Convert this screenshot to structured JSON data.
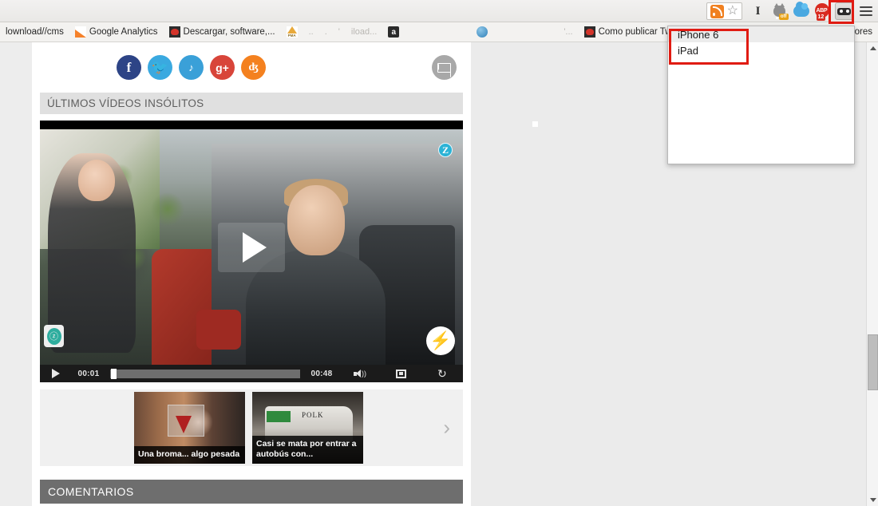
{
  "browser": {
    "toolbar": {
      "icons": [
        {
          "name": "rss-icon",
          "label": "RSS"
        },
        {
          "name": "bookmark-star-icon",
          "label": "Bookmark"
        },
        {
          "name": "evernote-icon",
          "label": "I"
        },
        {
          "name": "ghostery-icon",
          "label": "off"
        },
        {
          "name": "cloud-icon",
          "label": "Cloud"
        },
        {
          "name": "adblock-plus-icon",
          "label": "ABP",
          "badge": "12"
        },
        {
          "name": "user-agent-switcher-icon",
          "label": "User Agent Switcher"
        },
        {
          "name": "menu-icon",
          "label": "Menu"
        }
      ],
      "evernote_label": "I",
      "ghostery_badge": "off",
      "abp_label": "ABP",
      "abp_badge": "12"
    },
    "bookmarks": [
      {
        "label": "lownload//cms",
        "icon": "none"
      },
      {
        "label": "Google Analytics",
        "icon": "chart-icon"
      },
      {
        "label": "Descargar, software,...",
        "icon": "download-icon"
      },
      {
        "label": "PMA",
        "icon": "phpmyadmin-icon"
      },
      {
        "label": "..",
        "icon": "none"
      },
      {
        "label": ".",
        "icon": "none"
      },
      {
        "label": "'",
        "icon": "none"
      },
      {
        "label": "iload...",
        "icon": "none"
      },
      {
        "label": "",
        "icon": "amazon-icon"
      },
      {
        "label": "",
        "icon": "blue-orb-icon"
      },
      {
        "label": "'...",
        "icon": "none"
      },
      {
        "label": "Como publicar Tw",
        "icon": "download-icon"
      },
      {
        "label": "lores",
        "icon": "none"
      }
    ]
  },
  "ua_panel": {
    "items": [
      {
        "label": "iPhone 6",
        "hovered": true
      },
      {
        "label": "iPad",
        "hovered": false
      }
    ]
  },
  "page": {
    "social": {
      "items": [
        {
          "name": "facebook-icon",
          "glyph": "f"
        },
        {
          "name": "twitter-icon",
          "glyph": "ᵗ"
        },
        {
          "name": "meneame-icon",
          "glyph": "♪"
        },
        {
          "name": "google-plus-icon",
          "glyph": "g+"
        },
        {
          "name": "orange-share-icon",
          "glyph": "ʒ"
        }
      ],
      "mail_icon": "envelope-icon"
    },
    "section_title": "ÚLTIMOS VÍDEOS INSÓLITOS",
    "player": {
      "current_time": "00:01",
      "duration": "00:48",
      "play_label": "Play",
      "volume_label": "Volume",
      "fullscreen_label": "Fullscreen",
      "loop_label": "Replay",
      "watermark": "Z",
      "bolt_badge": "⚡",
      "left_badge": "ⓩ"
    },
    "thumbnails": [
      {
        "title": "Una broma... algo pesada",
        "selected": true
      },
      {
        "title": "Casi se mata por entrar a autobús con...",
        "selected": false
      }
    ],
    "thumb2_overlay_text": "POLK",
    "next_arrow": "›",
    "comments_title": "COMENTARIOS"
  },
  "colors": {
    "accent_red": "#e01b12",
    "selected_thumb_border": "#c2185b",
    "section_bar_bg": "#e0e0e0",
    "comments_bar_bg": "#6e6e6e",
    "player_bg": "#000000"
  }
}
